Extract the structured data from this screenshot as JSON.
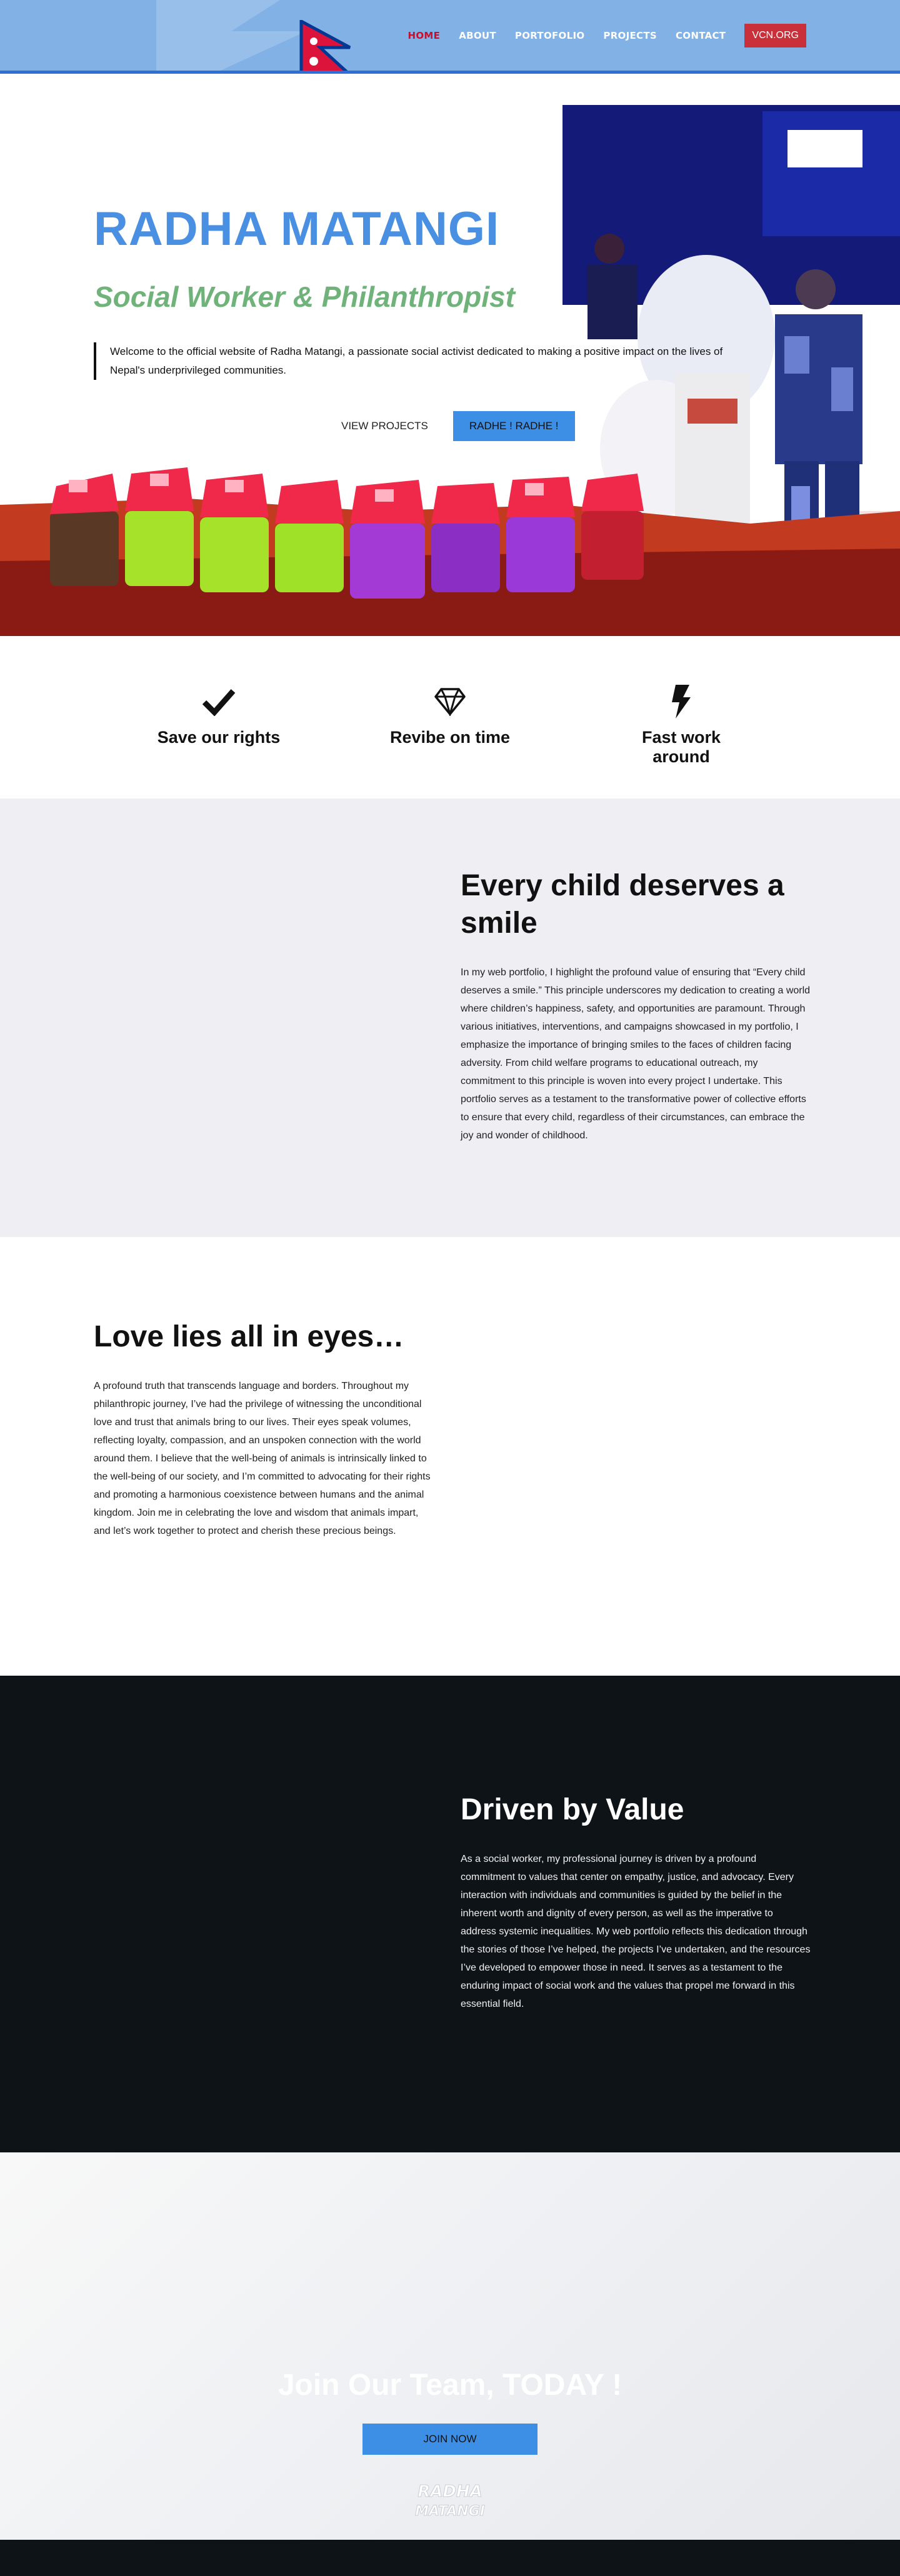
{
  "nav": {
    "links": [
      "HOME",
      "ABOUT",
      "PORTOFOLIO",
      "PROJECTS",
      "CONTACT"
    ],
    "active_index": 0,
    "cta": "VCN.ORG",
    "logo_icon": "nepal-flag-icon"
  },
  "hero": {
    "title": "RADHA MATANGI",
    "subtitle": "Social Worker & Philanthropist",
    "intro": "Welcome to the official website of Radha Matangi, a passionate social activist dedicated to making a positive impact on the lives of Nepal's underprivileged communities.",
    "btn_secondary": "VIEW PROJECTS",
    "btn_primary": "RADHE ! RADHE !"
  },
  "features": [
    {
      "icon": "checkmark-icon",
      "label": "Save our rights"
    },
    {
      "icon": "diamond-icon",
      "label": "Revibe on time"
    },
    {
      "icon": "lightning-icon",
      "label": "Fast work around"
    }
  ],
  "child": {
    "title": "Every child deserves a smile",
    "body": "In my web portfolio, I highlight the profound value of ensuring that “Every child deserves a smile.” This principle underscores my dedication to creating a world where children’s happiness, safety, and opportunities are paramount. Through various initiatives, interventions, and campaigns showcased in my portfolio, I emphasize the importance of bringing smiles to the faces of children facing adversity. From child welfare programs to educational outreach, my commitment to this principle is woven into every project I undertake. This portfolio serves as a testament to the transformative power of collective efforts to ensure that every child, regardless of their circumstances, can embrace the joy and wonder of childhood."
  },
  "love": {
    "title": "Love lies all in eyes…",
    "body": "A profound truth that transcends language and borders. Throughout my philanthropic journey, I’ve had the privilege of witnessing the unconditional love and trust that animals bring to our lives. Their eyes speak volumes, reflecting loyalty, compassion, and an unspoken connection with the world around them. I believe that the well-being of animals is intrinsically linked to the well-being of our society, and I’m committed to advocating for their rights and promoting a harmonious coexistence between humans and the animal kingdom. Join me in celebrating the love and wisdom that animals impart, and let’s work together to protect and cherish these precious beings."
  },
  "driven": {
    "title": "Driven by Value",
    "body": "As a social worker, my professional journey is driven by a profound commitment to values that center on empathy, justice, and advocacy. Every interaction with individuals and communities is guided by the belief in the inherent worth and dignity of every person, as well as the imperative to address systemic inequalities. My web portfolio reflects this dedication through the stories of those I’ve helped, the projects I’ve undertaken, and the resources I’ve developed to empower those in need. It serves as a testament to the enduring impact of social work and the values that propel me forward in this essential field."
  },
  "join": {
    "title": "Join Our Team, TODAY !",
    "button": "JOIN NOW",
    "logo_text": "RADHA MATANGI"
  },
  "colors": {
    "nav_bg": "#82b1e6",
    "nav_active": "#c8102e",
    "cta_bg": "#c9303a",
    "accent_blue": "#4a90e2",
    "subtitle_green": "#6fb37a",
    "button_blue": "#3d8fe6",
    "dark_bg": "#0e1318",
    "light_bg": "#eeeef3"
  }
}
